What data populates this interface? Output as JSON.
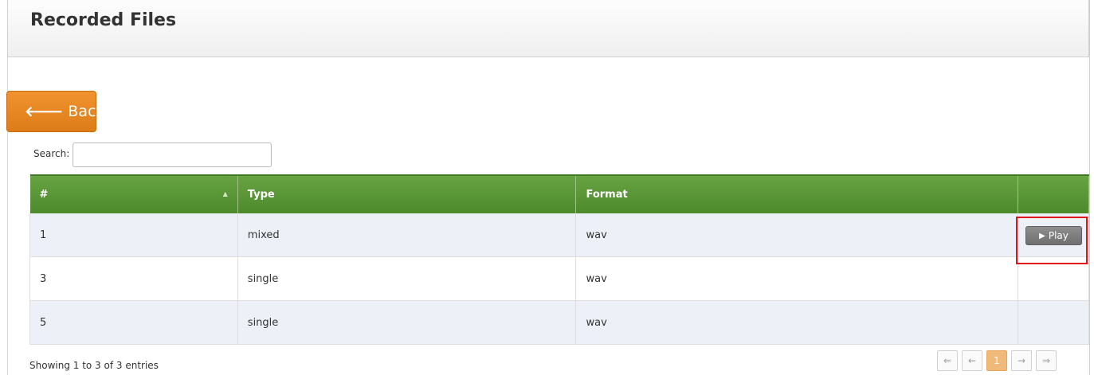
{
  "header": {
    "title": "Recorded Files"
  },
  "back_button": {
    "icon": "arrow-left-icon",
    "label": "Back"
  },
  "search": {
    "label": "Search:",
    "value": "",
    "placeholder": ""
  },
  "table": {
    "columns": [
      "#",
      "Type",
      "Format",
      ""
    ],
    "rows": [
      {
        "num": "1",
        "type": "mixed",
        "format": "wav",
        "action": "Play"
      },
      {
        "num": "3",
        "type": "single",
        "format": "wav",
        "action": ""
      },
      {
        "num": "5",
        "type": "single",
        "format": "wav",
        "action": ""
      }
    ]
  },
  "footer": {
    "info": "Showing 1 to 3 of 3 entries"
  },
  "pagination": {
    "first": "⇐",
    "prev": "←",
    "current": "1",
    "next": "→",
    "last": "⇒"
  },
  "colors": {
    "accent_orange": "#e8861f",
    "header_green": "#5a9636",
    "highlight_red": "#e0141a"
  }
}
